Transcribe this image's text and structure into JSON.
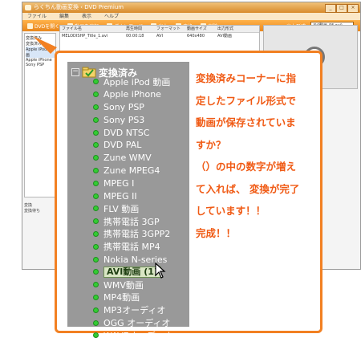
{
  "app": {
    "title": "らくちん動画変換 ‹ DVD Premium",
    "menu": [
      "ファイル",
      "編集",
      "表示",
      "ヘルプ"
    ],
    "toolbar": [
      "DVDを開く",
      "動画を追加",
      "ダウンロード",
      "出力",
      "変換",
      "削除"
    ],
    "format_label": "出力形式:",
    "format_value": "AVI動画 (M.avi)",
    "tree_items": [
      "変換済み",
      "変換済み",
      "Apple iPod 動画",
      "Apple iPhone",
      "Sony PSP"
    ],
    "table_headers": [
      "ファイル名",
      "再生時間",
      "フォーマット",
      "動画サイズ",
      "出力形式"
    ],
    "table_row": [
      "MELODISHP_Title_1.avi",
      "00:00:18",
      "AVI",
      "640x480",
      "AVI動画"
    ],
    "bottom_labels": [
      "変換",
      "変換待ち"
    ]
  },
  "tree": {
    "root_label": "変換済み",
    "collapse_symbol": "−",
    "items": [
      "Apple iPod 動画",
      "Apple iPhone",
      "Sony PSP",
      "Sony PS3",
      "DVD NTSC",
      "DVD PAL",
      "Zune WMV",
      "Zune MPEG4",
      "MPEG I",
      "MPEG II",
      "FLV 動画",
      "携帯電話 3GP",
      "携帯電話 3GPP2",
      "携帯電話 MP4",
      "Nokia N-series",
      "AVI動画 (1)",
      "WMV動画",
      "MP4動画",
      "MP3オーディオ",
      "OGG オーディオ",
      "WAVEオーディオ"
    ],
    "selected_item": "AVI動画 (1)"
  },
  "message_lines": [
    "変換済みコーナーに指",
    "定したファイル形式で",
    "動画が保存されていま",
    "すか？",
    "（）の中の数字が増え",
    "て入れば、 変換が完了",
    "しています！！",
    "完成！！"
  ],
  "colors": {
    "accent_orange": "#f28022",
    "message_text": "#f05a14",
    "tree_background": "#999999",
    "status_dot": "#33cc33"
  }
}
